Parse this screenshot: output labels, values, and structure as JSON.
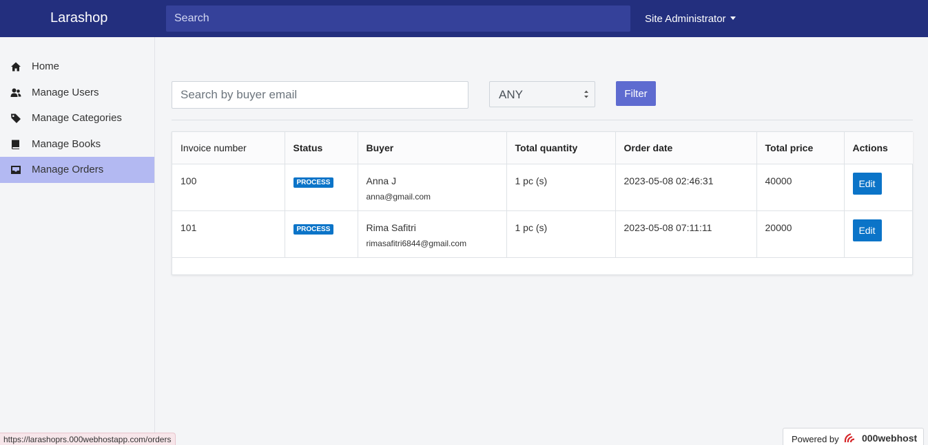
{
  "header": {
    "brand": "Larashop",
    "search_placeholder": "Search",
    "user_menu": "Site Administrator"
  },
  "sidebar": {
    "items": [
      {
        "label": "Home",
        "icon": "home-icon"
      },
      {
        "label": "Manage Users",
        "icon": "users-icon"
      },
      {
        "label": "Manage Categories",
        "icon": "tag-icon"
      },
      {
        "label": "Manage Books",
        "icon": "book-icon"
      },
      {
        "label": "Manage Orders",
        "icon": "inbox-icon",
        "active": true
      }
    ]
  },
  "filters": {
    "email_placeholder": "Search by buyer email",
    "status_value": "ANY",
    "filter_label": "Filter"
  },
  "table": {
    "headers": [
      "Invoice number",
      "Status",
      "Buyer",
      "Total quantity",
      "Order date",
      "Total price",
      "Actions"
    ],
    "rows": [
      {
        "invoice": "100",
        "status": "PROCESS",
        "buyer_name": "Anna J",
        "buyer_email": "anna@gmail.com",
        "quantity": "1 pc (s)",
        "date": "2023-05-08 02:46:31",
        "price": "40000",
        "action": "Edit"
      },
      {
        "invoice": "101",
        "status": "PROCESS",
        "buyer_name": "Rima Safitri",
        "buyer_email": "rimasafitri6844@gmail.com",
        "quantity": "1 pc (s)",
        "date": "2023-05-08 07:11:11",
        "price": "20000",
        "action": "Edit"
      }
    ]
  },
  "browser_status": {
    "url": "https://larashoprs.000webhostapp.com/orders"
  },
  "powered_by": {
    "text": "Powered by",
    "brand": "000webhost"
  },
  "colors": {
    "topbar": "#232f7e",
    "active_sidebar": "#b3b9f2",
    "filter_button": "#5e6bd0",
    "badge": "#0b74c8",
    "edit_button": "#0b74c8"
  }
}
